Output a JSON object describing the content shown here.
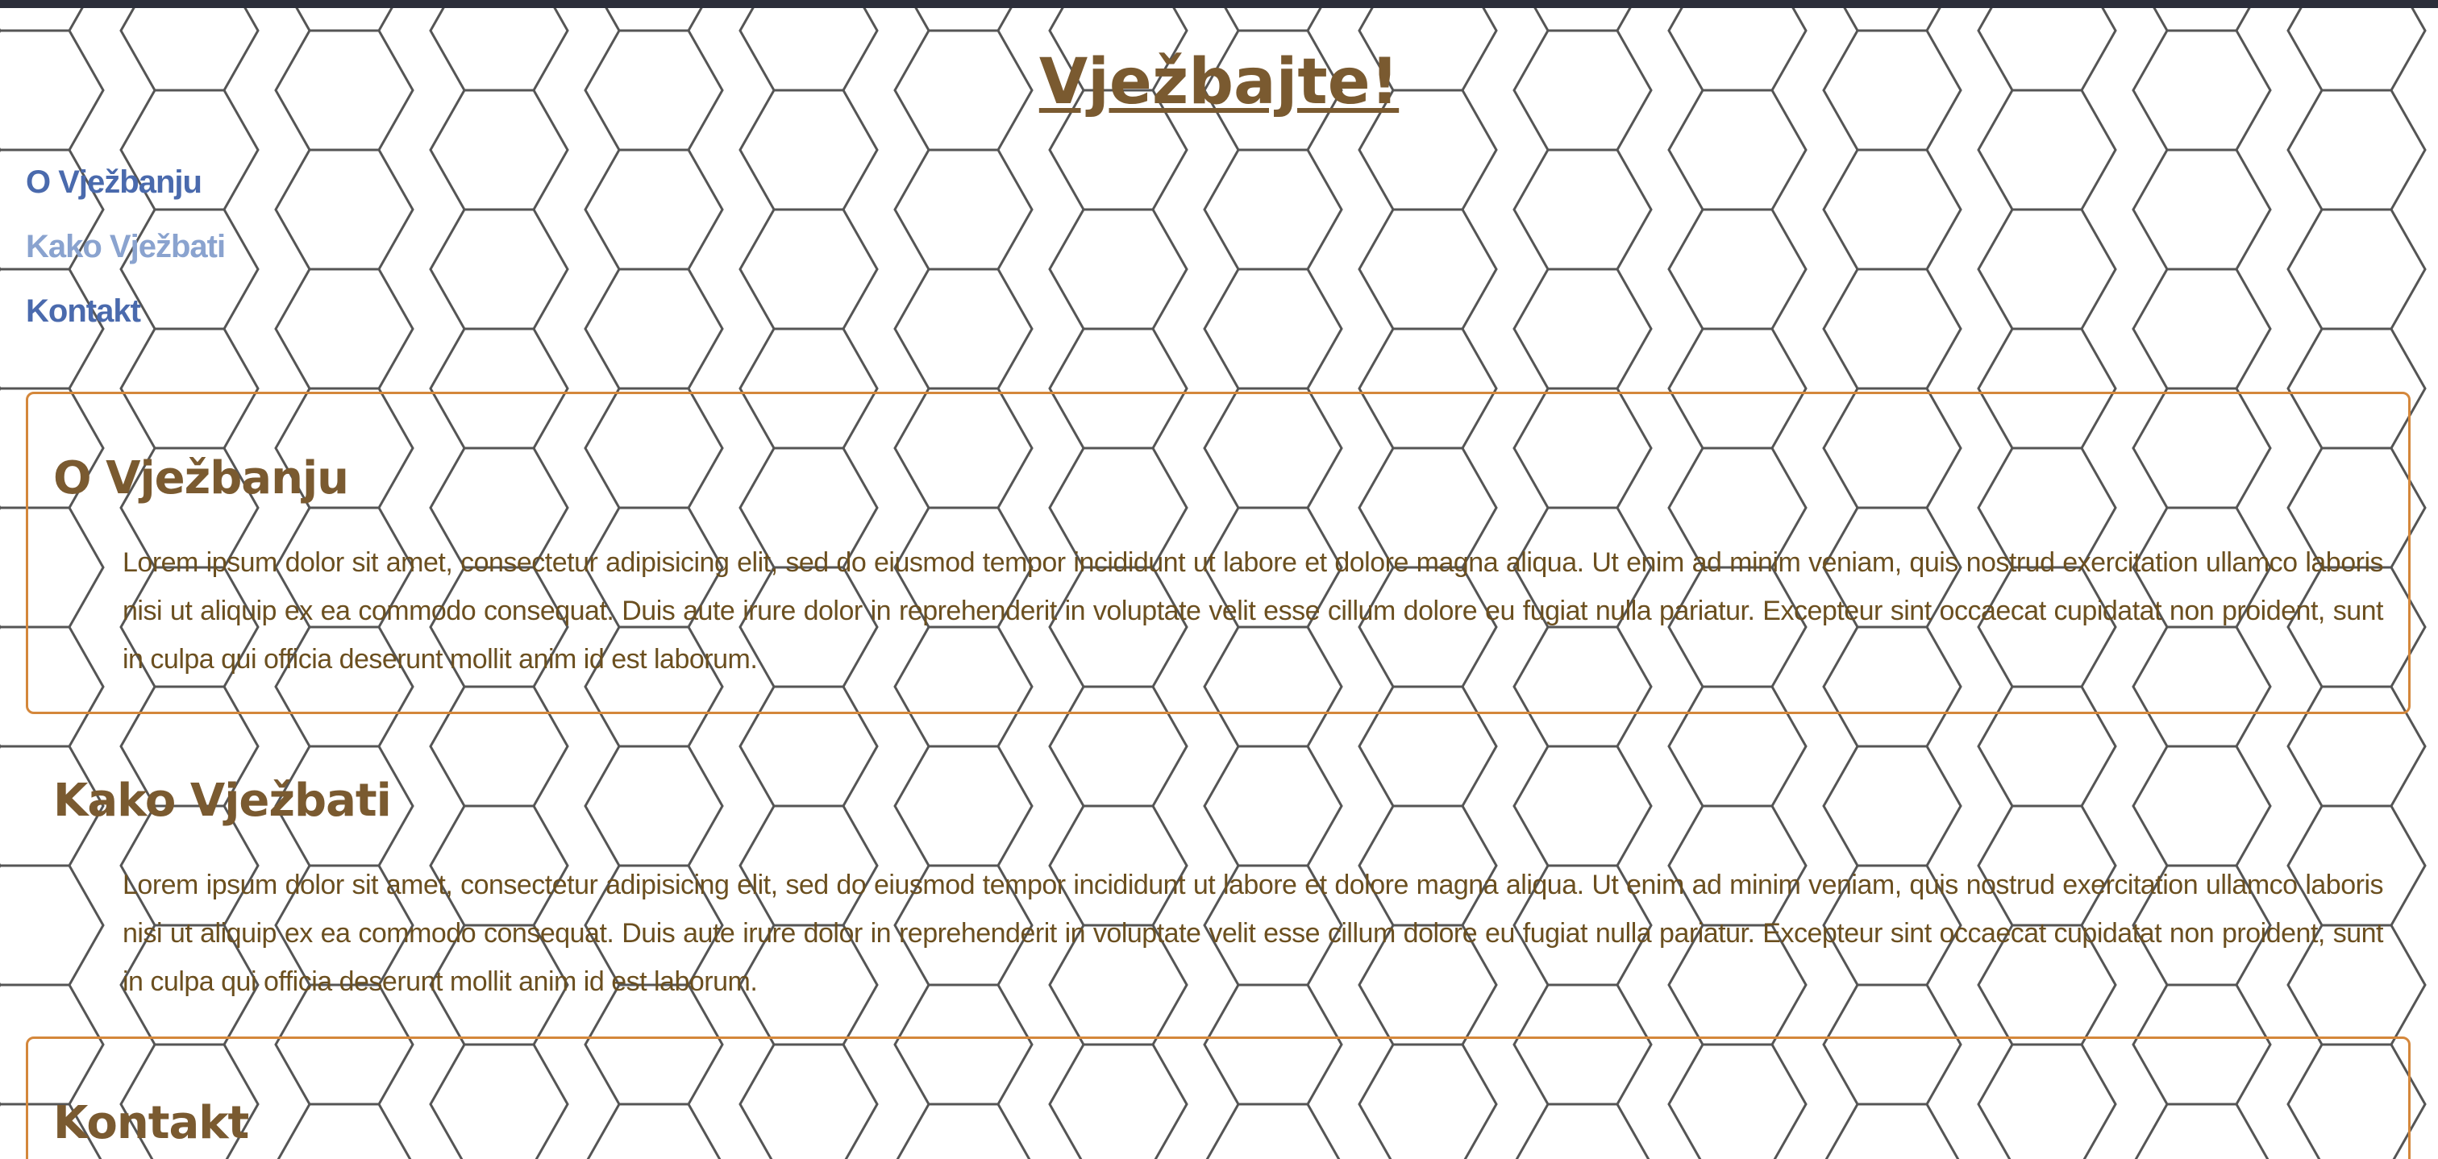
{
  "site": {
    "title": "Vježbajte!"
  },
  "nav": {
    "items": [
      {
        "label": "O Vježbanju",
        "state": "normal"
      },
      {
        "label": "Kako Vježbati",
        "state": "hover"
      },
      {
        "label": "Kontakt",
        "state": "normal"
      }
    ]
  },
  "sections": [
    {
      "heading": "O Vježbanju",
      "body": "Lorem ipsum dolor sit amet, consectetur adipisicing elit, sed do eiusmod tempor incididunt ut labore et dolore magna aliqua. Ut enim ad minim veniam, quis nostrud exercitation ullamco laboris nisi ut aliquip ex ea commodo consequat. Duis aute irure dolor in reprehenderit in voluptate velit esse cillum dolore eu fugiat nulla pariatur. Excepteur sint occaecat cupidatat non proident, sunt in culpa qui officia deserunt mollit anim id est laborum.",
      "bordered": true
    },
    {
      "heading": "Kako Vježbati",
      "body": "Lorem ipsum dolor sit amet, consectetur adipisicing elit, sed do eiusmod tempor incididunt ut labore et dolore magna aliqua. Ut enim ad minim veniam, quis nostrud exercitation ullamco laboris nisi ut aliquip ex ea commodo consequat. Duis aute irure dolor in reprehenderit in voluptate velit esse cillum dolore eu fugiat nulla pariatur. Excepteur sint occaecat cupidatat non proident, sunt in culpa qui officia deserunt mollit anim id est laborum.",
      "bordered": false
    },
    {
      "heading": "Kontakt",
      "bordered": true
    }
  ],
  "theme": {
    "heading_color": "#7a5a30",
    "body_text_color": "#6b4f1f",
    "link_color": "#4a6aad",
    "link_hover_color": "#8aa3cf",
    "section_border_color": "#d4873b",
    "top_bar_color": "#2c2e3a",
    "background_pattern": "hexagon-grid",
    "pattern_line_color": "#555555"
  }
}
